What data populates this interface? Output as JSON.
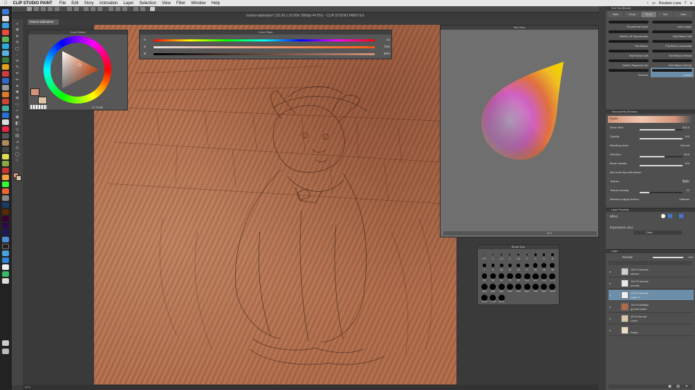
{
  "menubar": {
    "app": "CLIP STUDIO PAINT",
    "items": [
      "File",
      "Edit",
      "Story",
      "Animation",
      "Layer",
      "Selection",
      "View",
      "Filter",
      "Window",
      "Help"
    ],
    "user": "Reuben Lara"
  },
  "window": {
    "title": "boston-dalmation* (10.00 x 10.00in 300dpi 44.5%) - CLIP STUDIO PAINT EX",
    "doc_tab": "boston-dalmation",
    "zoom_status": "44.5"
  },
  "color_wheel": {
    "title": "Color Wheel",
    "main_color": "#d4937a",
    "sub_color": "#dcc5a5",
    "values": [
      "21",
      "70",
      "88"
    ]
  },
  "color_slider": {
    "title": "Color Slider",
    "rows": [
      {
        "label": "H",
        "value": "21",
        "fill": 0.06
      },
      {
        "label": "S",
        "value": "70%",
        "fill": 0.7
      },
      {
        "label": "B",
        "value": "88%",
        "fill": 0.88
      }
    ]
  },
  "sub_view": {
    "title": "Sub View",
    "zoom": "24.1"
  },
  "brush_size": {
    "title": "Brush Size",
    "sizes": [
      "0.7",
      "1",
      "1.5",
      "2",
      "2.5",
      "3",
      "4",
      "5",
      "6",
      "7",
      "8",
      "10",
      "12",
      "15",
      "17",
      "20",
      "25",
      "30",
      "40",
      "50",
      "60",
      "70",
      "80",
      "100",
      "120",
      "150",
      "170",
      "200",
      "250",
      "300",
      "400",
      "500",
      "600",
      "700",
      "800",
      "1000",
      "1500",
      "1700",
      "2000"
    ]
  },
  "sub_tool": {
    "title": "Sub Tool [Brush]",
    "tabs": [
      "Wate",
      "Oil pa",
      "Oil pai",
      "Gou",
      "India"
    ],
    "brushes": [
      {
        "name": "Oil paint flat brush",
        "col": 0
      },
      {
        "name": "Cat's tongue",
        "col": 1
      },
      {
        "name": "DAUB | Ink Tapered flaw",
        "col": 0
      },
      {
        "name": "Flat Ribbon Soft",
        "col": 1
      },
      {
        "name": "Flat Ribbon",
        "col": 0
      },
      {
        "name": "Flat Ribbon Horizontal",
        "col": 1
      },
      {
        "name": "Flat Ribbon Soft",
        "col": 0
      },
      {
        "name": "Flat Ribbon Vertical",
        "col": 1
      },
      {
        "name": "DAUB | Pigmento 10x",
        "col": 0
      },
      {
        "name": "Flat Ribbon Soft (3)",
        "col": 1
      },
      {
        "name": "Textured",
        "col": 0
      },
      {
        "name": "Smoke",
        "col": 1
      }
    ]
  },
  "tool_property": {
    "title": "Tool property [Smoke]",
    "brush_name": "Smoke",
    "rows": [
      {
        "label": "Brush Size",
        "value": "816.5",
        "fill": 0.82
      },
      {
        "label": "Opacity",
        "value": "100",
        "fill": 1.0
      },
      {
        "label": "Blending mode",
        "value": "Normal",
        "fill": null
      },
      {
        "label": "Direction",
        "value": "58.5",
        "fill": 0.58
      },
      {
        "label": "Brush density",
        "value": "100",
        "fill": 1.0
      },
      {
        "label": "Mix brush tips with darker",
        "value": "",
        "fill": null
      },
      {
        "label": "Texture",
        "value": "質感2",
        "fill": null
      },
      {
        "label": "Texture density",
        "value": "22",
        "fill": 0.22
      },
      {
        "label": "Method to apply texture",
        "value": "Subtract",
        "fill": null
      }
    ]
  },
  "layer_property": {
    "title": "Layer Property",
    "effect_label": "Effect",
    "expression_label": "Expression color",
    "expression_value": "Color"
  },
  "layers": {
    "title": "Layer",
    "blend": "Normal",
    "opacity": "100",
    "items": [
      {
        "l1": "100 % Normal",
        "l2": "source",
        "thumb": "#cfcfcf",
        "selected": false
      },
      {
        "l1": "100 % Normal",
        "l2": "pencils",
        "thumb": "#e8e8e8",
        "selected": false
      },
      {
        "l1": "100 % Normal",
        "l2": "Layer 3",
        "thumb": "#eeeeee",
        "selected": true
      },
      {
        "l1": "100 % Multiply",
        "l2": "ground wash",
        "thumb": "#b06a48",
        "selected": false
      },
      {
        "l1": "49 % Normal",
        "l2": "Linen",
        "thumb": "#d8c7a8",
        "selected": false
      },
      {
        "l1": "",
        "l2": "Paper",
        "thumb": "#e8dcc4",
        "selected": false
      }
    ]
  }
}
